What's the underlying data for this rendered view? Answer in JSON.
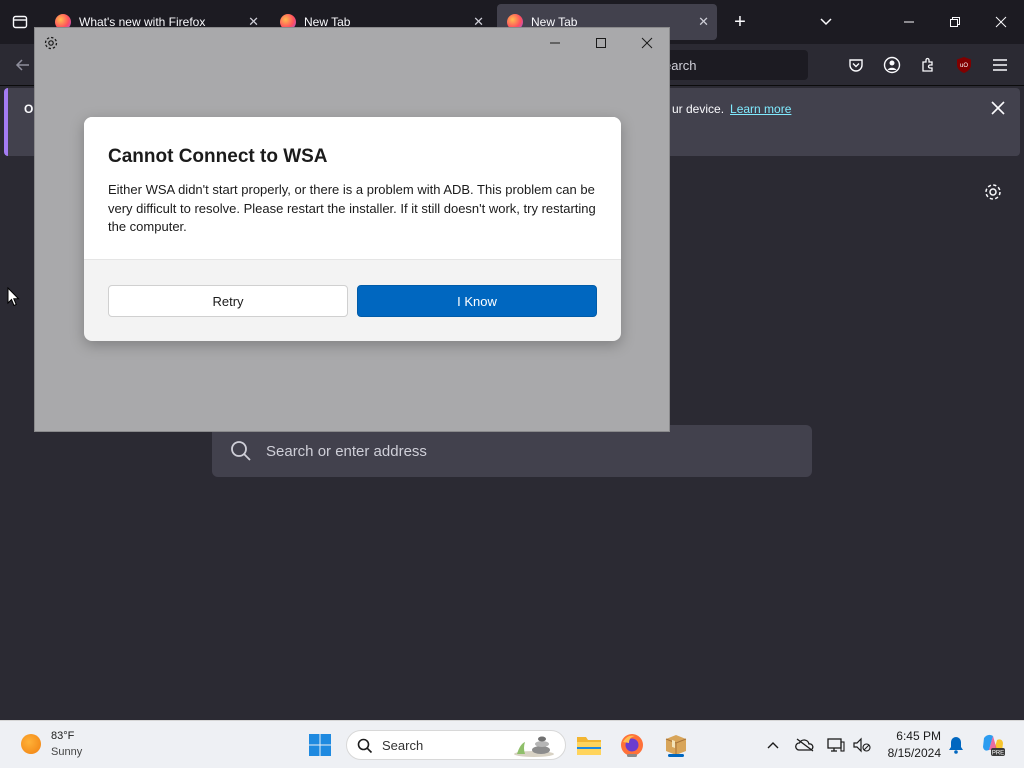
{
  "browser": {
    "tabs": [
      {
        "label": "What's new with Firefox",
        "active": false
      },
      {
        "label": "New Tab",
        "active": false
      },
      {
        "label": "New Tab",
        "active": true
      }
    ],
    "url_placeholder": "earch",
    "notification": {
      "bold_prefix": "Op",
      "text": "ur device.",
      "link": "Learn more"
    },
    "newtab_search_placeholder": "Search or enter address",
    "accent_color": "#a47cf3"
  },
  "dialog": {
    "title": "Cannot Connect to WSA",
    "message": "Either WSA didn't start properly, or there is a problem with ADB. This problem can be very difficult to resolve. Please restart the installer. If it still doesn't work, try restarting the computer.",
    "retry_label": "Retry",
    "primary_label": "I Know",
    "primary_color": "#0067c0"
  },
  "taskbar": {
    "weather": {
      "temp": "83°F",
      "condition": "Sunny"
    },
    "search_label": "Search",
    "time": "6:45 PM",
    "date": "8/15/2024",
    "apps": [
      "windows-start-icon",
      "file-explorer-icon",
      "firefox-icon",
      "wsa-installer-icon"
    ]
  }
}
